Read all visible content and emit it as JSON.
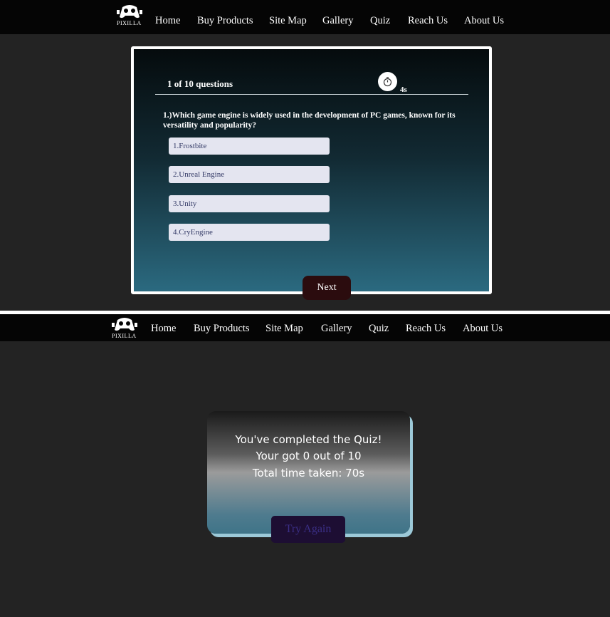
{
  "logo": {
    "text": "PIXILLA",
    "icon": "game-controller-logo-icon"
  },
  "nav": {
    "items": [
      "Home",
      "Buy Products",
      "Site Map",
      "Gallery",
      "Quiz",
      "Reach Us",
      "About Us"
    ]
  },
  "quiz": {
    "progress": "1 of 10 questions",
    "timer": {
      "icon": "stopwatch-icon",
      "value": "4s"
    },
    "question": "1.)Which game engine is widely used in the development of PC games, known for its versatility and popularity?",
    "options": [
      "1.Frostbite",
      "2.Unreal Engine",
      "3.Unity",
      "4.CryEngine"
    ],
    "next_label": "Next"
  },
  "result": {
    "line1": "You've completed the Quiz!",
    "line2": "Your got 0 out of 10",
    "line3": "Total time taken: 70s",
    "try_again_label": "Try Again"
  },
  "colors": {
    "page_background": "#232323",
    "navbar": "#050505",
    "next_button": "#2b0c0e",
    "try_again_button": "#1d0e33",
    "option_background": "#e4e5f0"
  }
}
